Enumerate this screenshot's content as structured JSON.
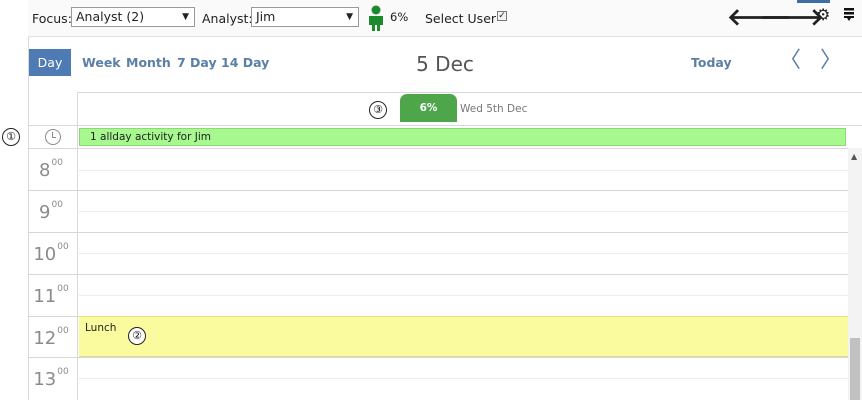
{
  "toolbar": {
    "focus_label": "Focus:",
    "focus_value": "Analyst (2)",
    "analyst_label": "Analyst:",
    "analyst_value": "Jim",
    "user_percent": "6%",
    "select_user_label": "Select User",
    "select_user_checked": true,
    "back_icon": "arrow-left-icon",
    "forward_icon": "arrow-right-icon",
    "settings_icon": "gear-icon",
    "menu_icon": "list-icon",
    "person_icon_color": "#1e8a2e"
  },
  "views": {
    "day": "Day",
    "week": "Week",
    "month": "Month",
    "seven_day": "7 Day",
    "fourteen_day": "14 Day",
    "active": "Day"
  },
  "header": {
    "date_title": "5 Dec",
    "today": "Today",
    "prev_icon": "chevron-left-icon",
    "next_icon": "chevron-right-icon"
  },
  "day_column": {
    "percent": "6%",
    "label": "Wed 5th Dec",
    "percent_color": "#4ea54a"
  },
  "allday": {
    "text": "1 allday activity for Jim",
    "color": "#a7f88e"
  },
  "hours": [
    {
      "h": "8",
      "m": "00"
    },
    {
      "h": "9",
      "m": "00"
    },
    {
      "h": "10",
      "m": "00"
    },
    {
      "h": "11",
      "m": "00"
    },
    {
      "h": "12",
      "m": "00"
    },
    {
      "h": "13",
      "m": "00"
    }
  ],
  "events": [
    {
      "title": "Lunch",
      "color": "#fafa9e"
    }
  ],
  "callouts": [
    "①",
    "②",
    "③"
  ]
}
